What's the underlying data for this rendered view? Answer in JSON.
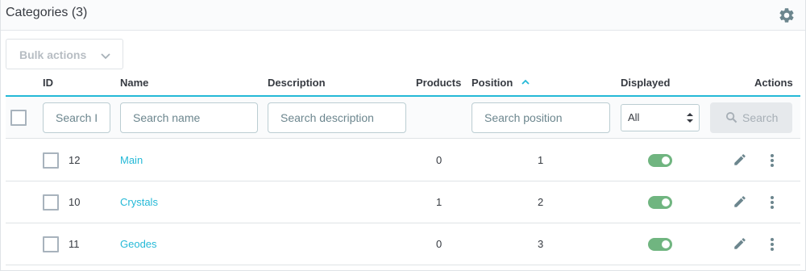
{
  "header": {
    "title": "Categories (3)",
    "settings_icon": "gear-icon"
  },
  "bulk_actions": {
    "label": "Bulk actions",
    "icon": "chevron-down-icon"
  },
  "columns": {
    "id": "ID",
    "name": "Name",
    "description": "Description",
    "products": "Products",
    "position": "Position",
    "displayed": "Displayed",
    "actions": "Actions"
  },
  "filters": {
    "id_placeholder": "Search I",
    "name_placeholder": "Search name",
    "description_placeholder": "Search description",
    "position_placeholder": "Search position",
    "displayed_value": "All",
    "search_label": "Search"
  },
  "rows": [
    {
      "id": "12",
      "name": "Main",
      "products": "0",
      "position": "1",
      "displayed": true
    },
    {
      "id": "10",
      "name": "Crystals",
      "products": "1",
      "position": "2",
      "displayed": true
    },
    {
      "id": "11",
      "name": "Geodes",
      "products": "0",
      "position": "3",
      "displayed": true
    }
  ],
  "colors": {
    "accent": "#25b9d7",
    "toggle_on": "#70b580",
    "border": "#dfe3e6"
  }
}
